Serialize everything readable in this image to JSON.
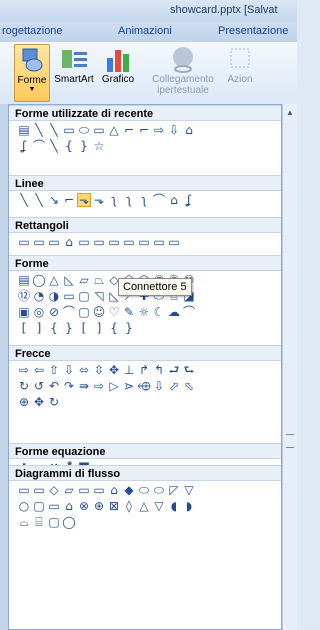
{
  "window": {
    "title": "showcard.pptx [Salvat"
  },
  "tabs": [
    {
      "label": "rogettazione"
    },
    {
      "label": "Animazioni"
    },
    {
      "label": "Presentazione"
    }
  ],
  "ribbon": {
    "buttons": [
      {
        "label": "Forme",
        "icon": "shapes-icon"
      },
      {
        "label": "SmartArt",
        "icon": "smartart-icon"
      },
      {
        "label": "Grafico",
        "icon": "chart-icon"
      },
      {
        "label": "Collegamento ipertestuale",
        "icon": "hyperlink-icon"
      },
      {
        "label": "Azion",
        "icon": "action-icon"
      }
    ]
  },
  "gallery": {
    "sections": [
      {
        "title": "Forme utilizzate di recente",
        "rows": [
          [
            "▤",
            "╲",
            "╲",
            "▭",
            "⬭",
            "▭",
            "△",
            "⌐",
            "⌐",
            "⇨",
            "⇩",
            "⌂"
          ],
          [
            "ʆ",
            "⌒",
            "╲",
            "{",
            "}",
            "☆"
          ]
        ]
      },
      {
        "title": "Linee",
        "rows": [
          [
            "╲",
            "╲",
            "↘",
            "⌐",
            "⬎",
            "⬎",
            "ʅ",
            "ʅ",
            "ʅ",
            "⌒",
            "⌂",
            "ʆ"
          ]
        ]
      },
      {
        "title": "Rettangoli",
        "rows": [
          [
            "▭",
            "▭",
            "▭",
            "⌂",
            "▭",
            "▭",
            "▭",
            "▭",
            "▭",
            "▭",
            "▭"
          ]
        ]
      },
      {
        "title": "Forme",
        "rows": [
          [
            "▤",
            "◯",
            "△",
            "◺",
            "▱",
            "⏢",
            "◇",
            "⬠",
            "⬡",
            "⑦",
            "⑧",
            "⑩"
          ],
          [
            "⑫",
            "◔",
            "◑",
            "▭",
            "▢",
            "◹",
            "◺",
            "⟋",
            "✚",
            "⬭",
            "⌸",
            "◪"
          ],
          [
            "▣",
            "◎",
            "⊘",
            "⌒",
            "▢",
            "☺",
            "♡",
            "✎",
            "☼",
            "☾",
            "☁",
            "⌒"
          ],
          [
            "[",
            "]",
            "{",
            "}",
            "[",
            "]",
            "{",
            "}"
          ]
        ]
      },
      {
        "title": "Frecce",
        "rows": [
          [
            "⇨",
            "⇦",
            "⇧",
            "⇩",
            "⬄",
            "⇳",
            "✥",
            "⊥",
            "↱",
            "↰",
            "⮐",
            "⮑"
          ],
          [
            "↻",
            "↺",
            "↶",
            "↷",
            "⇛",
            "⇨",
            "▷",
            "⋗",
            "⬲",
            "⇩",
            "⬀",
            "⬁"
          ],
          [
            "⊕",
            "✥",
            "↻"
          ]
        ]
      },
      {
        "title": "Forme equazione",
        "rows": [
          [
            "✚",
            "━",
            "✖",
            "➗",
            "〓",
            "≠"
          ]
        ]
      },
      {
        "title": "Diagrammi di flusso",
        "rows": [
          [
            "▭",
            "▭",
            "◇",
            "▱",
            "▭",
            "▭",
            "⌂",
            "◆",
            "⬭",
            "⬭",
            "◸",
            "▽"
          ],
          [
            "○",
            "▢",
            "▭",
            "⌂",
            "⊗",
            "⊕",
            "⊠",
            "◊",
            "△",
            "▽",
            "◖",
            "◗"
          ],
          [
            "⌓",
            "⌸",
            "▢",
            "◯"
          ]
        ]
      }
    ]
  },
  "tooltip": {
    "text": "Connettore 5"
  }
}
